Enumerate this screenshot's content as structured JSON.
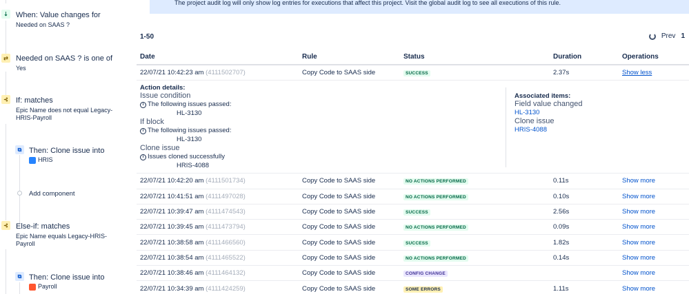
{
  "banner": {
    "text": "The project audit log will only show log entries for executions that affect this project. Visit the global audit log to see all executions of this rule."
  },
  "rule": {
    "trigger": {
      "title": "When: Value changes for",
      "sub": "Needed on SAAS ?"
    },
    "condition": {
      "title": "Needed on SAAS ? is one of",
      "sub": "Yes"
    },
    "if_branch": {
      "title": "If: matches",
      "sub": "Epic Name does not equal Legacy-HRIS-Payroll"
    },
    "if_action": {
      "title": "Then: Clone issue into",
      "project": "HRIS"
    },
    "add_component": "Add component",
    "else_branch": {
      "title": "Else-if: matches",
      "sub": "Epic Name equals Legacy-HRIS-Payroll"
    },
    "else_action": {
      "title": "Then: Clone issue into",
      "project": "Payroll"
    }
  },
  "pager": {
    "range": "1-50",
    "prev": "Prev",
    "page": "1"
  },
  "table": {
    "headers": {
      "date": "Date",
      "rule": "Rule",
      "status": "Status",
      "duration": "Duration",
      "operations": "Operations"
    },
    "expanded": {
      "date": "22/07/21 10:42:23 am",
      "id": "(4111502707)",
      "rule": "Copy Code to SAAS side",
      "status": "SUCCESS",
      "duration": "2.37s",
      "op": "Show less"
    },
    "details": {
      "label": "Action details:",
      "steps": [
        {
          "title": "Issue condition",
          "message": "The following issues passed:",
          "key": "HL-3130"
        },
        {
          "title": "If block",
          "message": "The following issues passed:",
          "key": "HL-3130"
        },
        {
          "title": "Clone issue",
          "message": "Issues cloned successfully",
          "key": "HRIS-4088"
        }
      ],
      "assoc_label": "Associated items:",
      "assoc": [
        {
          "type": "Field value changed",
          "key": "HL-3130"
        },
        {
          "type": "Clone issue",
          "key": "HRIS-4088"
        }
      ]
    },
    "rows": [
      {
        "date": "22/07/21 10:42:20 am",
        "id": "(4111501734)",
        "rule": "Copy Code to SAAS side",
        "status": "NO ACTIONS PERFORMED",
        "kind": "none",
        "duration": "0.11s",
        "op": "Show more"
      },
      {
        "date": "22/07/21 10:41:51 am",
        "id": "(4111497028)",
        "rule": "Copy Code to SAAS side",
        "status": "NO ACTIONS PERFORMED",
        "kind": "none",
        "duration": "0.10s",
        "op": "Show more"
      },
      {
        "date": "22/07/21 10:39:47 am",
        "id": "(4111474543)",
        "rule": "Copy Code to SAAS side",
        "status": "SUCCESS",
        "kind": "success",
        "duration": "2.56s",
        "op": "Show more"
      },
      {
        "date": "22/07/21 10:39:45 am",
        "id": "(4111473794)",
        "rule": "Copy Code to SAAS side",
        "status": "NO ACTIONS PERFORMED",
        "kind": "none",
        "duration": "0.09s",
        "op": "Show more"
      },
      {
        "date": "22/07/21 10:38:58 am",
        "id": "(4111466560)",
        "rule": "Copy Code to SAAS side",
        "status": "SUCCESS",
        "kind": "success",
        "duration": "1.82s",
        "op": "Show more"
      },
      {
        "date": "22/07/21 10:38:54 am",
        "id": "(4111465522)",
        "rule": "Copy Code to SAAS side",
        "status": "NO ACTIONS PERFORMED",
        "kind": "none",
        "duration": "0.14s",
        "op": "Show more"
      },
      {
        "date": "22/07/21 10:38:46 am",
        "id": "(4111464132)",
        "rule": "Copy Code to SAAS side",
        "status": "CONFIG CHANGE",
        "kind": "config",
        "duration": "",
        "op": "Show more"
      },
      {
        "date": "22/07/21 10:34:39 am",
        "id": "(4111424259)",
        "rule": "Copy Code to SAAS side",
        "status": "SOME ERRORS",
        "kind": "errors",
        "duration": "1.11s",
        "op": "Show more"
      }
    ]
  },
  "colors": {
    "link": "#0052cc",
    "banner": "#deebff",
    "success_bg": "#e3fcef",
    "config_bg": "#eae6ff",
    "errors_bg": "#fff0b3"
  }
}
